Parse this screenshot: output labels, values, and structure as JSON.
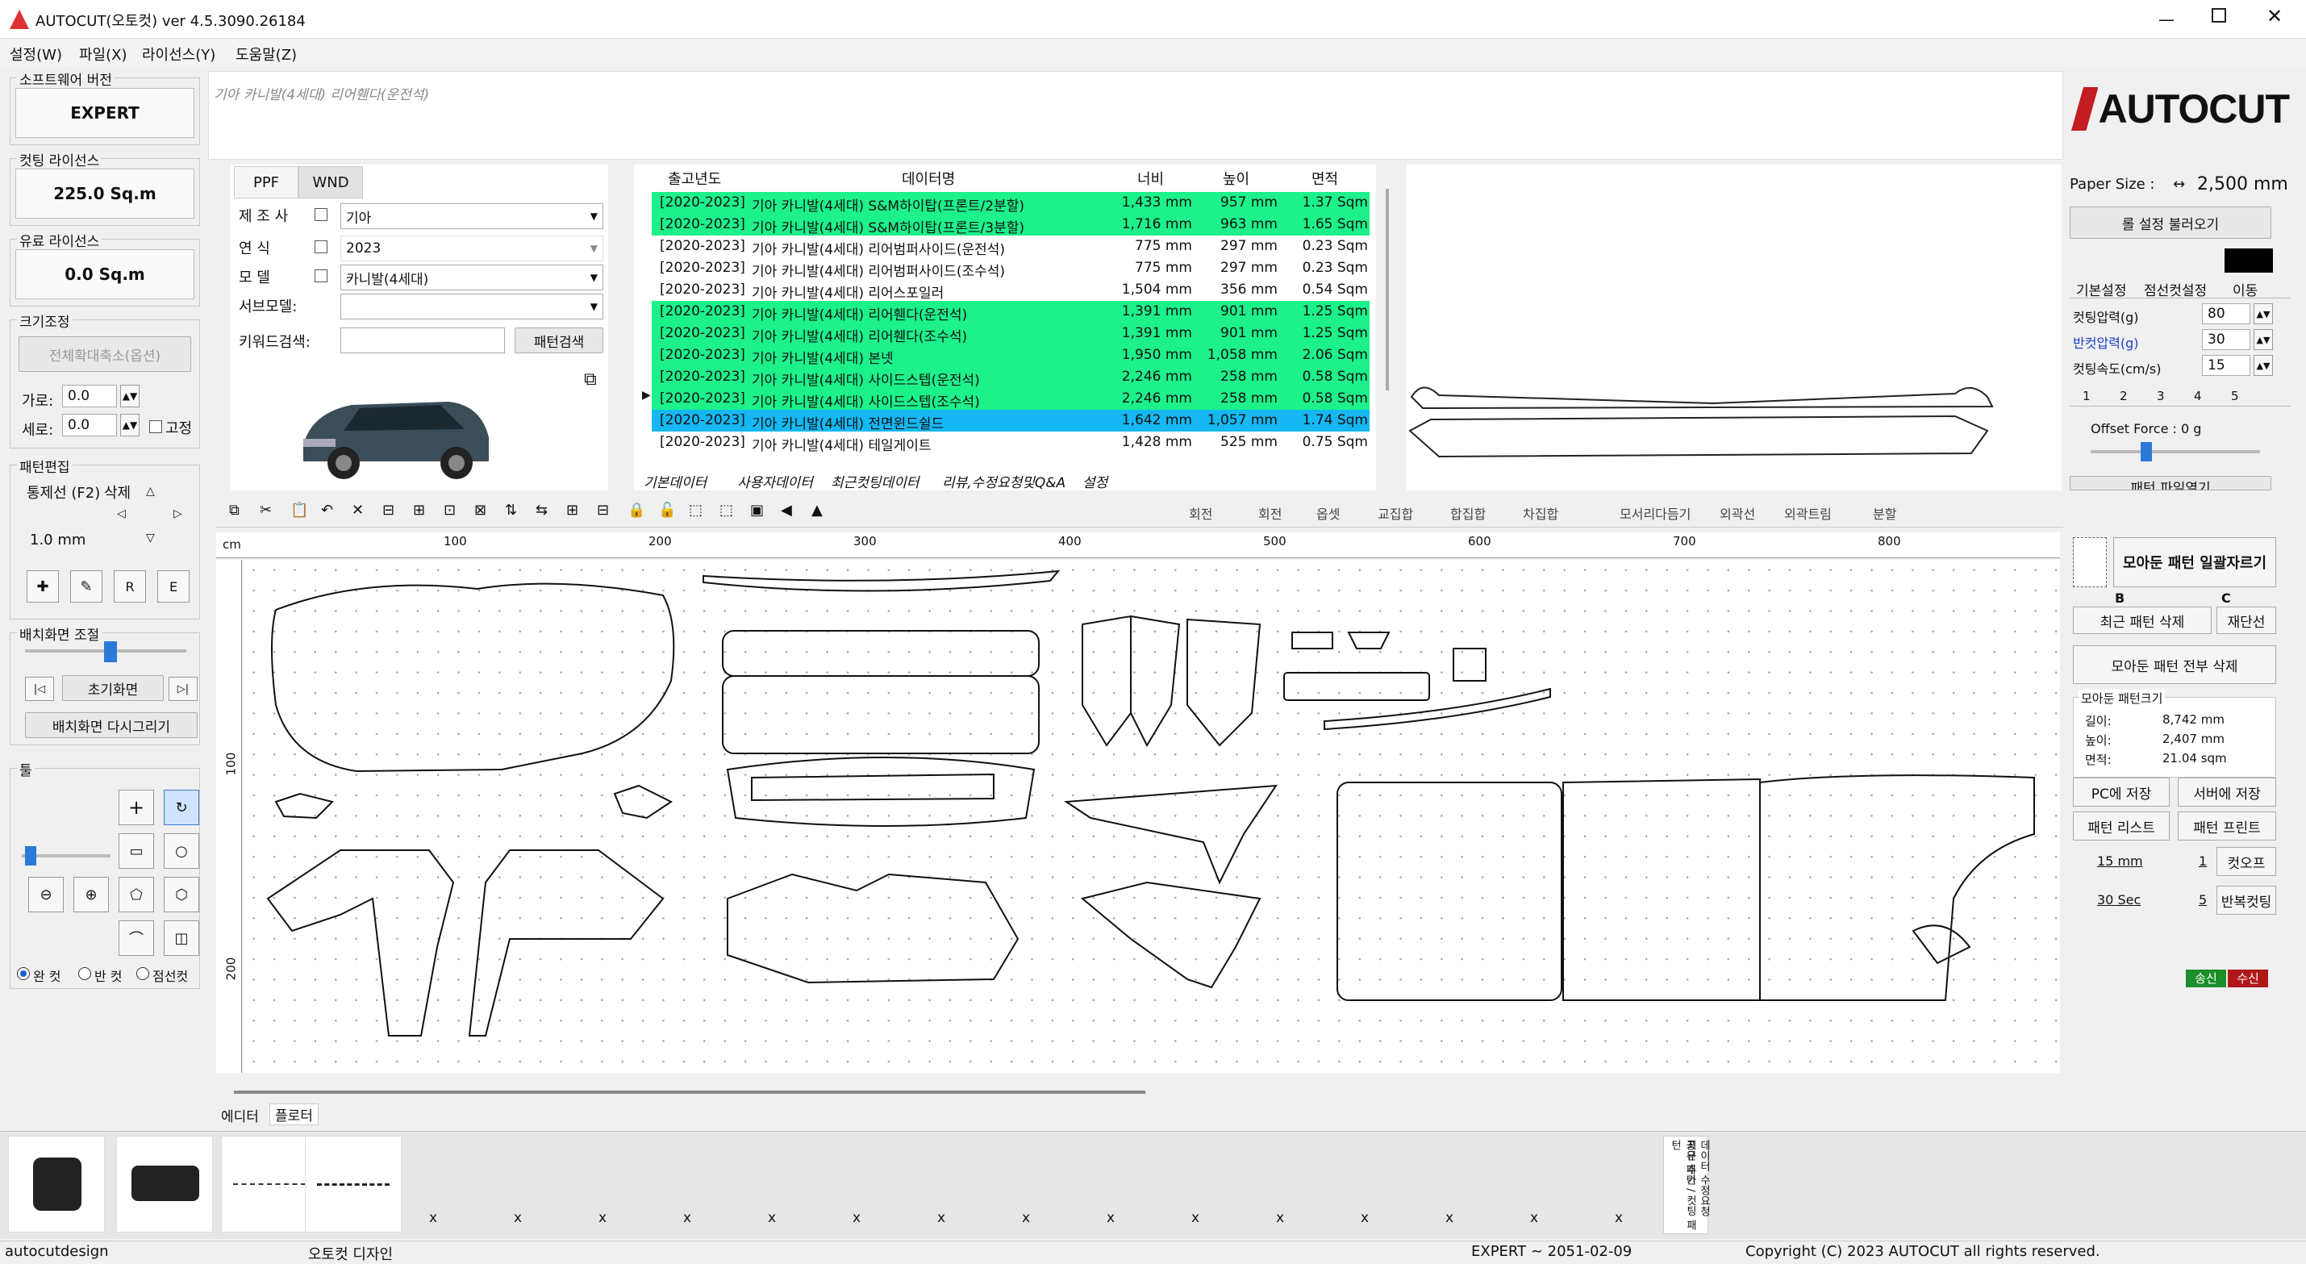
{
  "window": {
    "title": "AUTOCUT(오토컷) ver 4.5.3090.26184",
    "controls": [
      "minimize",
      "maximize",
      "close"
    ]
  },
  "menu": [
    "설정(W)",
    "파일(X)",
    "라이선스(Y)",
    "도움말(Z)"
  ],
  "left_panel": {
    "software_version_label": "소프트웨어 버전",
    "software_version": "EXPERT",
    "cutting_license_label": "컷팅 라이선스",
    "cutting_license": "225.0 Sq.m",
    "paid_license_label": "유료 라이선스",
    "paid_license": "0.0 Sq.m",
    "size_adjust_label": "크기조정",
    "full_scale_button": "전체확대축소(옵션)",
    "width_label": "가로:",
    "width_value": "0.0",
    "height_label": "세로:",
    "height_value": "0.0",
    "fix_label": "고정",
    "pattern_edit_label": "패턴편집",
    "move_label": "통제선 (F2)",
    "delete_label": "삭제",
    "step_value": "1.0 mm",
    "r_button": "R",
    "e_button": "E",
    "layout_label": "배치화면 조절",
    "reset_view_button": "초기화면",
    "redraw_button": "배치화면 다시그리기",
    "tools_label": "툴",
    "cut_modes": [
      "완 컷",
      "반 컷",
      "점선컷"
    ],
    "cut_mode_selected": "완 컷"
  },
  "header": {
    "model_title": "기아 카니발(4세대) 리어휀다(운전석)",
    "brand": "AUTOCUT"
  },
  "search_panel": {
    "tabs": [
      "PPF",
      "WND"
    ],
    "active_tab": "PPF",
    "maker_label": "제 조 사",
    "maker_value": "기아",
    "year_label": "연 식",
    "year_value": "2023",
    "model_label": "모 델",
    "model_value": "카니발(4세대)",
    "submodel_label": "서브모델:",
    "submodel_value": "",
    "keyword_label": "키워드검색:",
    "keyword_value": "",
    "search_button": "패턴검색"
  },
  "data_table": {
    "headers": [
      "출고년도",
      "데이터명",
      "너비",
      "높이",
      "면적"
    ],
    "rows": [
      {
        "year": "[2020-2023]",
        "name": "기아 카니발(4세대) S&M하이탑(프론트/2분할)",
        "w": "1,433 mm",
        "h": "957 mm",
        "a": "1.37 Sqm",
        "hl": "green"
      },
      {
        "year": "[2020-2023]",
        "name": "기아 카니발(4세대) S&M하이탑(프론트/3분할)",
        "w": "1,716 mm",
        "h": "963 mm",
        "a": "1.65 Sqm",
        "hl": "green"
      },
      {
        "year": "[2020-2023]",
        "name": "기아 카니발(4세대) 리어범퍼사이드(운전석)",
        "w": "775 mm",
        "h": "297 mm",
        "a": "0.23 Sqm",
        "hl": ""
      },
      {
        "year": "[2020-2023]",
        "name": "기아 카니발(4세대) 리어범퍼사이드(조수석)",
        "w": "775 mm",
        "h": "297 mm",
        "a": "0.23 Sqm",
        "hl": ""
      },
      {
        "year": "[2020-2023]",
        "name": "기아 카니발(4세대) 리어스포일러",
        "w": "1,504 mm",
        "h": "356 mm",
        "a": "0.54 Sqm",
        "hl": ""
      },
      {
        "year": "[2020-2023]",
        "name": "기아 카니발(4세대) 리어휀다(운전석)",
        "w": "1,391 mm",
        "h": "901 mm",
        "a": "1.25 Sqm",
        "hl": "green"
      },
      {
        "year": "[2020-2023]",
        "name": "기아 카니발(4세대) 리어휀다(조수석)",
        "w": "1,391 mm",
        "h": "901 mm",
        "a": "1.25 Sqm",
        "hl": "green"
      },
      {
        "year": "[2020-2023]",
        "name": "기아 카니발(4세대) 본넷",
        "w": "1,950 mm",
        "h": "1,058 mm",
        "a": "2.06 Sqm",
        "hl": "green"
      },
      {
        "year": "[2020-2023]",
        "name": "기아 카니발(4세대) 사이드스텝(운전석)",
        "w": "2,246 mm",
        "h": "258 mm",
        "a": "0.58 Sqm",
        "hl": "green"
      },
      {
        "year": "[2020-2023]",
        "name": "기아 카니발(4세대) 사이드스텝(조수석)",
        "w": "2,246 mm",
        "h": "258 mm",
        "a": "0.58 Sqm",
        "hl": "green"
      },
      {
        "year": "[2020-2023]",
        "name": "기아 카니발(4세대) 전면윈드쉴드",
        "w": "1,642 mm",
        "h": "1,057 mm",
        "a": "1.74 Sqm",
        "hl": "blue"
      },
      {
        "year": "[2020-2023]",
        "name": "기아 카니발(4세대) 테일게이트",
        "w": "1,428 mm",
        "h": "525 mm",
        "a": "0.75 Sqm",
        "hl": ""
      }
    ],
    "bottom_tabs": [
      "기본데이터",
      "사용자데이터",
      "최근컷팅데이터",
      "리뷰,수정요청및Q&A",
      "설정"
    ]
  },
  "right_panel": {
    "paper_size_label": "Paper Size :",
    "paper_size_value": "2,500 mm",
    "roll_button": "롤 설정 불러오기",
    "tabs": [
      "기본설정",
      "점선컷설정",
      "이동"
    ],
    "active_tab": "기본설정",
    "pressure_label": "컷팅압력(g)",
    "pressure_value": "80",
    "half_pressure_label": "반컷압력(g)",
    "half_pressure_value": "30",
    "speed_label": "컷팅속도(cm/s)",
    "speed_value": "15",
    "number_tabs": [
      "1",
      "2",
      "3",
      "4",
      "5"
    ],
    "offset_label": "Offset Force : 0 g",
    "file_button": "패턴 파일열기",
    "all_cut_button": "모아둔 패턴 일괄자르기",
    "b_label": "B",
    "c_label": "C",
    "delete_recent": "최근 패턴 삭제",
    "recut": "재단선",
    "delete_all": "모아둔 패턴 전부 삭제",
    "size_label": "모아둔 패턴크기",
    "length_label": "길이:",
    "length_value": "8,742 mm",
    "height_label": "높이:",
    "height_value": "2,407 mm",
    "area_label": "면적:",
    "area_value": "21.04 sqm",
    "save_pc": "PC에 저장",
    "save_server": "서버에 저장",
    "pattern_list": "패턴 리스트",
    "pattern_print": "패턴 프린트",
    "offset_mm": "15 mm",
    "offset_count": "1",
    "cutoff": "컷오프",
    "repeat_sec": "30 Sec",
    "repeat_count": "5",
    "repeat_cut": "반복컷팅",
    "send": "송신",
    "receive": "수신"
  },
  "toolbar": {
    "labels": [
      "회전",
      "회전",
      "옵셋",
      "교집합",
      "합집합",
      "차집합",
      "모서리다듬기",
      "외곽선",
      "외곽트림",
      "분할"
    ]
  },
  "ruler": {
    "unit": "cm",
    "x_ticks": [
      "100",
      "200",
      "300",
      "400",
      "500",
      "600",
      "700",
      "800"
    ],
    "y_ticks": [
      "100",
      "200"
    ]
  },
  "canvas_tabs": [
    "에디터",
    "플로터"
  ],
  "active_canvas_tab": "플로터",
  "bottom_strip": {
    "marks": [
      "x",
      "x",
      "x",
      "x",
      "x",
      "x",
      "x",
      "x",
      "x",
      "x",
      "x",
      "x",
      "x",
      "x",
      "x"
    ],
    "vertical_labels": [
      "최근 추가 / 컷팅 패턴",
      "공유 패턴",
      "데이터 수정요청"
    ]
  },
  "status": {
    "user": "autocutdesign",
    "design": "오토컷 디자인",
    "license": "EXPERT ~ 2051-02-09",
    "copyright": "Copyright (C) 2023 AUTOCUT all rights reserved."
  }
}
